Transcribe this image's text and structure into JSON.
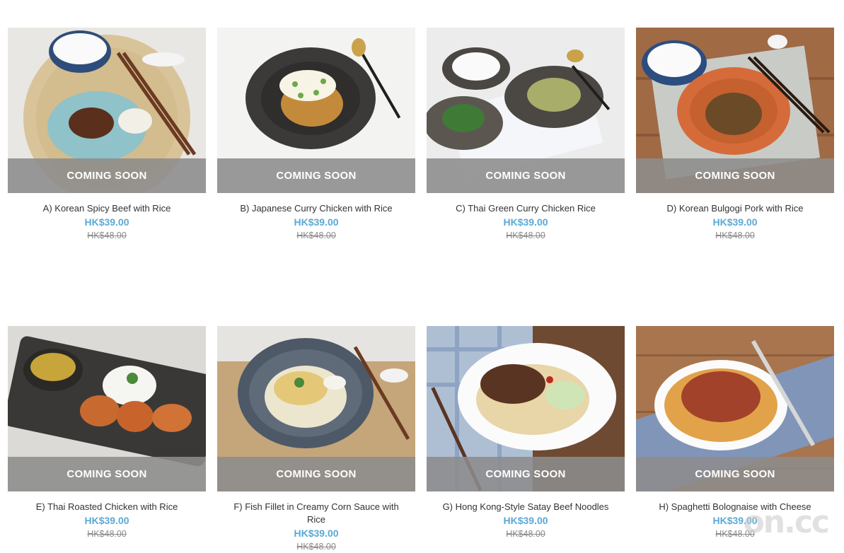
{
  "banner_text": "COMING SOON",
  "products": [
    {
      "name": "A) Korean Spicy Beef with Rice",
      "price": "HK$39.00",
      "original_price": "HK$48.00"
    },
    {
      "name": "B) Japanese Curry Chicken with Rice",
      "price": "HK$39.00",
      "original_price": "HK$48.00"
    },
    {
      "name": "C) Thai Green Curry Chicken Rice",
      "price": "HK$39.00",
      "original_price": "HK$48.00"
    },
    {
      "name": "D) Korean Bulgogi Pork with Rice",
      "price": "HK$39.00",
      "original_price": "HK$48.00"
    },
    {
      "name": "E) Thai Roasted Chicken with Rice",
      "price": "HK$39.00",
      "original_price": "HK$48.00"
    },
    {
      "name": "F) Fish Fillet in Creamy Corn Sauce with Rice",
      "price": "HK$39.00",
      "original_price": "HK$48.00"
    },
    {
      "name": "G) Hong Kong-Style Satay Beef Noodles",
      "price": "HK$39.00",
      "original_price": "HK$48.00"
    },
    {
      "name": "H) Spaghetti Bolognaise with Cheese",
      "price": "HK$39.00",
      "original_price": "HK$48.00"
    }
  ],
  "watermark": "on.cc",
  "colors": {
    "price": "#5aa9d6",
    "banner": "#8c8c8c",
    "original_price": "#8a8a8a"
  }
}
